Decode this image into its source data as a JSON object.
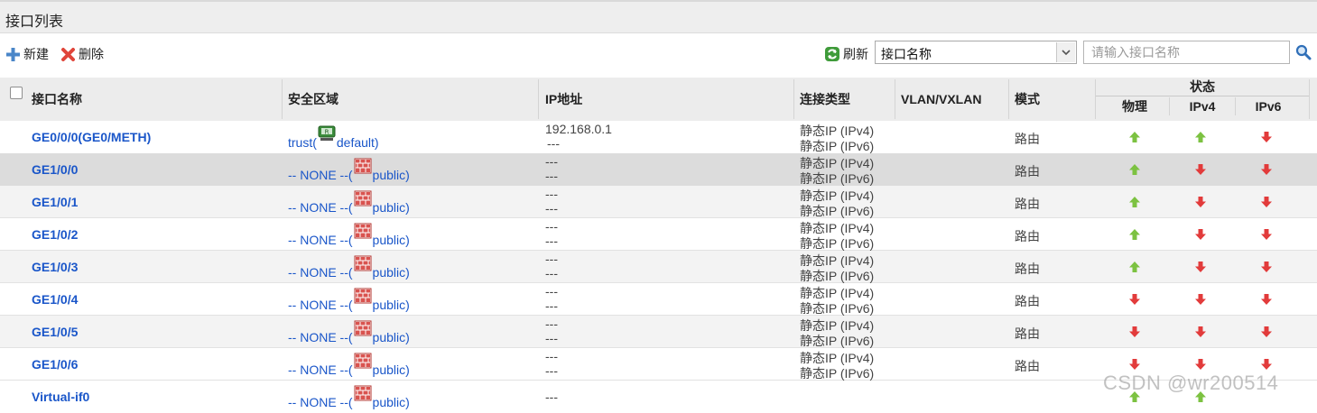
{
  "panel": {
    "title": "接口列表"
  },
  "toolbar": {
    "new_label": "新建",
    "delete_label": "删除",
    "refresh_label": "刷新",
    "filter_select": {
      "selected": "接口名称"
    },
    "search": {
      "placeholder": "请输入接口名称"
    }
  },
  "table": {
    "columns": {
      "name": "接口名称",
      "zone": "安全区域",
      "ip": "IP地址",
      "conn_type": "连接类型",
      "vlan": "VLAN/VXLAN",
      "mode": "模式",
      "status": "状态",
      "status_sub": [
        "物理",
        "IPv4",
        "IPv6"
      ]
    },
    "rows": [
      {
        "name": "GE0/0/0(GE0/METH)",
        "zone_prefix": "trust(",
        "zone_icon": "vsys-icon",
        "zone_suffix": "default)",
        "ip": [
          "192.168.0.1",
          "---"
        ],
        "conn": [
          "静态IP (IPv4)",
          "静态IP (IPv6)"
        ],
        "mode": "路由",
        "status": [
          "up",
          "up",
          "down"
        ]
      },
      {
        "name": "GE1/0/0",
        "zone_prefix": "-- NONE --(",
        "zone_icon": "firewall-icon",
        "zone_suffix": "public)",
        "ip": [
          "---",
          "---"
        ],
        "conn": [
          "静态IP (IPv4)",
          "静态IP (IPv6)"
        ],
        "mode": "路由",
        "status": [
          "up",
          "down",
          "down"
        ]
      },
      {
        "name": "GE1/0/1",
        "zone_prefix": "-- NONE --(",
        "zone_icon": "firewall-icon",
        "zone_suffix": "public)",
        "ip": [
          "---",
          "---"
        ],
        "conn": [
          "静态IP (IPv4)",
          "静态IP (IPv6)"
        ],
        "mode": "路由",
        "status": [
          "up",
          "down",
          "down"
        ]
      },
      {
        "name": "GE1/0/2",
        "zone_prefix": "-- NONE --(",
        "zone_icon": "firewall-icon",
        "zone_suffix": "public)",
        "ip": [
          "---",
          "---"
        ],
        "conn": [
          "静态IP (IPv4)",
          "静态IP (IPv6)"
        ],
        "mode": "路由",
        "status": [
          "up",
          "down",
          "down"
        ]
      },
      {
        "name": "GE1/0/3",
        "zone_prefix": "-- NONE --(",
        "zone_icon": "firewall-icon",
        "zone_suffix": "public)",
        "ip": [
          "---",
          "---"
        ],
        "conn": [
          "静态IP (IPv4)",
          "静态IP (IPv6)"
        ],
        "mode": "路由",
        "status": [
          "up",
          "down",
          "down"
        ]
      },
      {
        "name": "GE1/0/4",
        "zone_prefix": "-- NONE --(",
        "zone_icon": "firewall-icon",
        "zone_suffix": "public)",
        "ip": [
          "---",
          "---"
        ],
        "conn": [
          "静态IP (IPv4)",
          "静态IP (IPv6)"
        ],
        "mode": "路由",
        "status": [
          "down",
          "down",
          "down"
        ]
      },
      {
        "name": "GE1/0/5",
        "zone_prefix": "-- NONE --(",
        "zone_icon": "firewall-icon",
        "zone_suffix": "public)",
        "ip": [
          "---",
          "---"
        ],
        "conn": [
          "静态IP (IPv4)",
          "静态IP (IPv6)"
        ],
        "mode": "路由",
        "status": [
          "down",
          "down",
          "down"
        ]
      },
      {
        "name": "GE1/0/6",
        "zone_prefix": "-- NONE --(",
        "zone_icon": "firewall-icon",
        "zone_suffix": "public)",
        "ip": [
          "---",
          "---"
        ],
        "conn": [
          "静态IP (IPv4)",
          "静态IP (IPv6)"
        ],
        "mode": "路由",
        "status": [
          "down",
          "down",
          "down"
        ]
      },
      {
        "name": "Virtual-if0",
        "zone_prefix": "-- NONE --(",
        "zone_icon": "firewall-icon",
        "zone_suffix": "public)",
        "ip": [
          "---"
        ],
        "conn": [],
        "mode": "",
        "status": [
          "up",
          "up",
          ""
        ]
      }
    ]
  },
  "watermark": "CSDN @wr200514",
  "colors": {
    "link": "#1a56c9",
    "status_up": "#7cc241",
    "status_down": "#e23b3b",
    "selected_row": "#dcdcdc"
  }
}
